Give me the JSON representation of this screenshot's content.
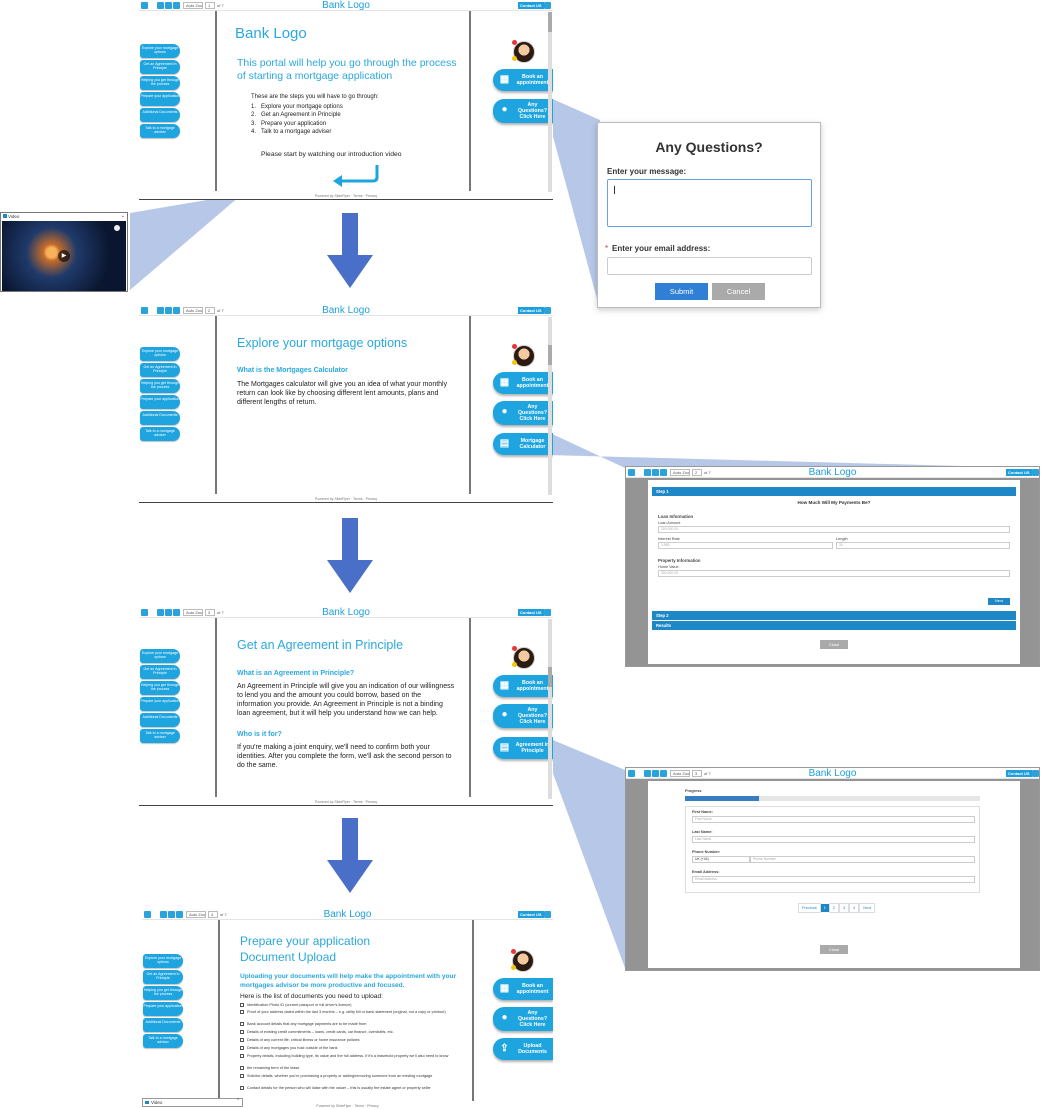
{
  "toolbar": {
    "zoom_label": "Auto Zoom",
    "page_of": "of 7",
    "title": "Bank Logo",
    "contact_us": "Contact US"
  },
  "nav": [
    "Explore your mortgage options",
    "Get an Agreement in Principle",
    "Helping you get through the process",
    "Prepare your application",
    "Additional Documents",
    "Talk to a mortgage adviser"
  ],
  "footer": "Powered by SlideFlyer · Terms · Privacy",
  "side_buttons": {
    "book": "Book an appointment",
    "questions": "Any Questions? Click Here",
    "calculator": "Mortgage Calculator",
    "aip": "Agreement in Principle",
    "upload": "Upload Documents"
  },
  "slide1": {
    "logo": "Bank Logo",
    "heading": "This portal will help you go through the process of starting a mortgage application",
    "intro": "These are the steps you will have to go through:",
    "steps": [
      "Explore your mortgage options",
      "Get an Agreement in Principle",
      "Prepare your application",
      "Talk to a mortgage adviser"
    ],
    "cta": "Please start by watching our introduction video"
  },
  "video_popup": {
    "label": "Video"
  },
  "questions_modal": {
    "title": "Any Questions?",
    "message_label": "Enter your message:",
    "email_label": "Enter your email address:",
    "required_mark": "*",
    "submit": "Submit",
    "cancel": "Cancel"
  },
  "slide2": {
    "heading": "Explore your mortgage options",
    "subheading": "What is the Mortgages Calculator",
    "body": "The Mortgages calculator will give you an idea of what your monthly return can look like by choosing different lent amounts, plans and different lengths of return."
  },
  "calculator": {
    "step1": "Step 1",
    "question": "How Much Will My Payments Be?",
    "loan_info": "Loan Information",
    "loan_amount": "Loan Amount",
    "loan_amount_value": "200,000.00",
    "interest_rate": "Interest Rate",
    "interest_value": "3.950",
    "length": "Length",
    "length_value": "30",
    "property_info": "Property Information",
    "home_value": "Home Value",
    "home_value_value": "300,000.00",
    "next": "Next",
    "step2": "Step 2",
    "results": "Results",
    "close": "Close"
  },
  "slide3": {
    "heading": "Get an Agreement in Principle",
    "sub1": "What is an Agreement in Principle?",
    "body1": "An Agreement in Principle will give you an indication of our willingness to lend you and the amount you could borrow, based on the information you provide. An Agreement in Principle is not a binding loan agreement, but it will help you understand how we can help.",
    "sub2": "Who is it for?",
    "body2": "If you're making a joint enquiry, we'll need to confirm both your identities. After you complete the form, we'll ask the second person to do the same."
  },
  "aip_form": {
    "progress": "Progress",
    "progress_fraction": 0.25,
    "first_name": "First Name:",
    "first_name_ph": "First Name",
    "last_name": "Last Name:",
    "last_name_ph": "Last Name",
    "phone": "Phone Number:",
    "country": "UK (+44)",
    "phone_ph": "Phone Number",
    "email": "Email Address:",
    "email_ph": "Email Address",
    "previous": "Previous",
    "pages": [
      "1",
      "2",
      "3",
      "4"
    ],
    "next": "Next",
    "close": "Close"
  },
  "slide4": {
    "heading1": "Prepare your application",
    "heading2": "Document Upload",
    "sub": "Uploading your documents will help make the appointment with your mortgages advisor be more productive and focused.",
    "intro": "Here is the list of documents you need to upload:",
    "docs": [
      "Identification Photo ID (current passport or full driver's licence)",
      "Proof of your address dated within the last 3 months – e.g. utility bill or bank statement (original, not a copy or printout)",
      "Bank account details that any mortgage payments are to be made from",
      "Details of existing credit commitments – loans, credit cards, car finance, overdrafts, etc.",
      "Details of any current life, critical illness or home insurance policies",
      "Details of any mortgages you hold outside of the bank",
      "Property details, including building type, its value and the full address. If it's a leasehold property we'll also need to know",
      "the remaining term of the lease",
      "Solicitor details, whether you're purchasing a property or adding/removing someone from an existing mortgage",
      "Contact details for the person who will liaise with the valuer – this is usually the estate agent or property seller"
    ],
    "video_label": "Video"
  },
  "colors": {
    "accent": "#1ea4de",
    "arrow": "#4a6fc9",
    "wedge": "#b6c7e8"
  }
}
